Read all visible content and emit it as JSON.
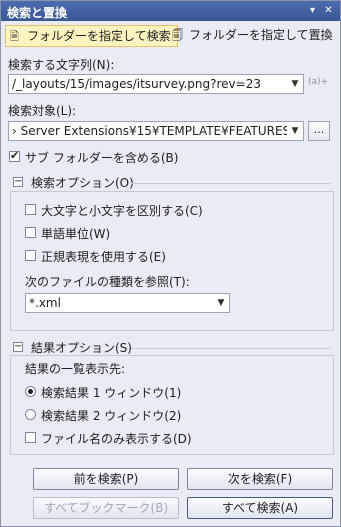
{
  "window": {
    "title": "検索と置換"
  },
  "tabs": [
    {
      "label": "フォルダーを指定して検索",
      "icon": "find-in-files-icon",
      "active": true
    },
    {
      "label": "フォルダーを指定して置換",
      "icon": "replace-in-files-icon",
      "active": false
    }
  ],
  "search": {
    "label": "検索する文字列(N):",
    "value": "/_layouts/15/images/itsurvey.png?rev=23",
    "expression_builder_label": "(a)+"
  },
  "look_in": {
    "label": "検索対象(L):",
    "value": "› Server Extensions¥15¥TEMPLATE¥FEATURES",
    "browse_label": "..."
  },
  "subfolders": {
    "label": "サブ フォルダーを含める(B)",
    "checked": true
  },
  "find_options": {
    "header": "検索オプション(O)",
    "match_case": {
      "label": "大文字と小文字を区別する(C)",
      "checked": false
    },
    "whole_word": {
      "label": "単語単位(W)",
      "checked": false
    },
    "regex": {
      "label": "正規表現を使用する(E)",
      "checked": false
    },
    "file_types_label": "次のファイルの種類を参照(T):",
    "file_types_value": "*.xml"
  },
  "result_options": {
    "header": "結果オプション(S)",
    "list_label": "結果の一覧表示先:",
    "result1": {
      "label": "検索結果 1 ウィンドウ(1)",
      "selected": true
    },
    "result2": {
      "label": "検索結果 2 ウィンドウ(2)",
      "selected": false
    },
    "filenames_only": {
      "label": "ファイル名のみ表示する(D)",
      "checked": false
    }
  },
  "buttons": {
    "find_previous": "前を検索(P)",
    "find_next": "次を検索(F)",
    "bookmark_all": "すべてブックマーク(B)",
    "find_all": "すべて検索(A)"
  }
}
